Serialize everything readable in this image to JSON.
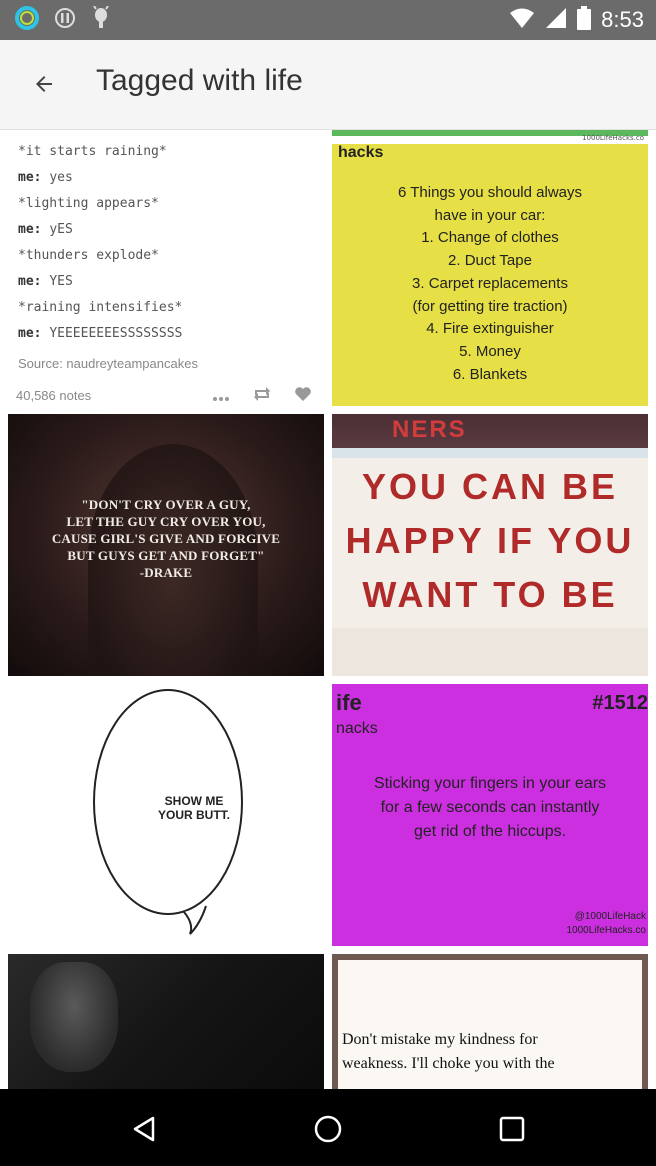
{
  "status_bar": {
    "time": "8:53",
    "left_icons": [
      "ring-app-icon",
      "alert-icon",
      "android-debug-icon"
    ],
    "right_icons": [
      "wifi-icon",
      "signal-icon",
      "battery-icon"
    ]
  },
  "app_bar": {
    "title": "Tagged with life",
    "back_icon": "arrow-back-icon"
  },
  "posts": {
    "text_post": {
      "lines": [
        {
          "speaker": "",
          "text": "*it starts raining*"
        },
        {
          "speaker": "me:",
          "text": "yes"
        },
        {
          "speaker": "",
          "text": "*lighting appears*"
        },
        {
          "speaker": "me:",
          "text": "yES"
        },
        {
          "speaker": "",
          "text": "*thunders explode*"
        },
        {
          "speaker": "me:",
          "text": "YES"
        },
        {
          "speaker": "",
          "text": "*raining intensifies*"
        },
        {
          "speaker": "me:",
          "text": "YEEEEEEEESSSSSSSS"
        }
      ],
      "source": "Source: naudreyteampancakes",
      "notes": "40,586 notes"
    },
    "life_hacks_car": {
      "top_url": "1000LifeHacks.co",
      "brand": "life\nhacks",
      "lines": [
        "6 Things you should always",
        "have in your car:",
        "1. Change of clothes",
        "2. Duct Tape",
        "3. Carpet replacements",
        "(for getting tire traction)",
        "4. Fire extinguisher",
        "5. Money",
        "6. Blankets"
      ]
    },
    "drake_quote": {
      "lines": [
        "\"DON'T CRY OVER A GUY,",
        "LET THE GUY CRY OVER YOU,",
        "CAUSE GIRL'S GIVE AND FORGIVE",
        "BUT GUYS GET AND FORGET\"",
        "-DRAKE"
      ]
    },
    "sign": {
      "top_text": "NERS",
      "lines": [
        "YOU CAN BE",
        "HAPPY IF YOU",
        "WANT TO BE"
      ]
    },
    "speech_bubble": {
      "text": "SHOW ME YOUR BUTT."
    },
    "life_hacks_hiccups": {
      "brand": "ife",
      "brand2": "nacks",
      "number": "#1512",
      "lines": [
        "Sticking your fingers in your ears",
        "for a few seconds can instantly",
        "get rid of the hiccups."
      ],
      "credit": [
        "@1000LifeHack",
        "1000LifeHacks.co"
      ]
    },
    "kindness_quote": {
      "lines": [
        "Don't mistake my kindness for",
        "weakness. I'll choke you with the"
      ]
    }
  },
  "nav_bar": {
    "back": "nav-back-icon",
    "home": "nav-home-icon",
    "recents": "nav-recents-icon"
  },
  "colors": {
    "status_bar": "#6b6b6b",
    "app_bar": "#f5f5f5",
    "yellow_card": "#e6df45",
    "purple_card": "#cc2fe0",
    "sign_red": "#b02a2a"
  }
}
